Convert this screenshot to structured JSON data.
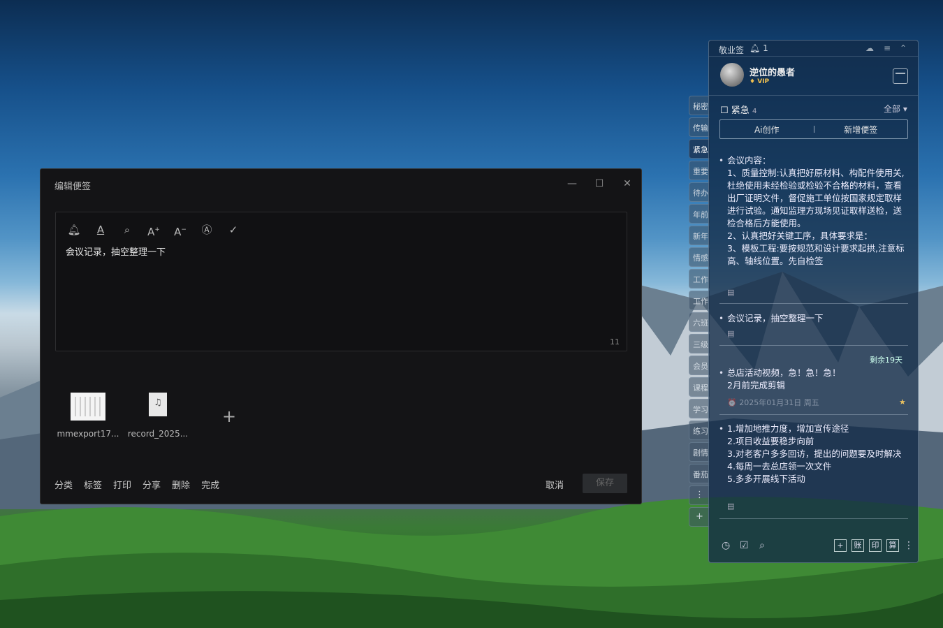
{
  "editor": {
    "title": "编辑便签",
    "window_controls": {
      "minimize": "—",
      "maximize": "☐",
      "close": "✕"
    },
    "toolbar": [
      "bell-icon",
      "text-underline-icon",
      "search-icon",
      "font-increase-icon",
      "font-decrease-icon",
      "auto-format-icon",
      "check-icon"
    ],
    "content": "会议记录，抽空整理一下",
    "char_count": "11",
    "attachments": [
      {
        "name": "mmexport17...",
        "type": "image"
      },
      {
        "name": "record_2025...",
        "type": "wav"
      }
    ],
    "add_attachment": "+",
    "actions": [
      "分类",
      "标签",
      "打印",
      "分享",
      "删除",
      "完成"
    ],
    "cancel": "取消",
    "save": "保存"
  },
  "side_tabs": [
    "秘密",
    "传输",
    "紧急",
    "重要",
    "待办",
    "年前",
    "新年",
    "情感",
    "工作",
    "工作",
    "六班",
    "三级",
    "会员",
    "课程",
    "学习",
    "练习",
    "剧情",
    "番茄"
  ],
  "side_tab_more": "⋮",
  "side_tab_add": "+",
  "panel": {
    "app_name": "敬业签",
    "reminder_count": "1",
    "user": {
      "name": "逆位的愚者",
      "badge": "VIP"
    },
    "category": {
      "name": "紧急",
      "count": "4",
      "filter": "全部"
    },
    "ai_button": "Ai创作",
    "new_button": "新增便签",
    "notes": [
      {
        "text": "会议内容：\n1、质量控制:认真把好原材料、构配件使用关,杜绝使用未经检验或检验不合格的材料，查看出厂证明文件，督促施工单位按国家规定取样进行试验。通知监理方现场见证取样送检，送检合格后方能使用。\n2、认真把好关键工序，具体要求是：\n3、模板工程:要按规范和设计要求起拱,注意标高、轴线位置。先自检签"
      },
      {
        "text": "会议记录，抽空整理一下"
      },
      {
        "text": "总店活动视频，急！急！急！\n2月前完成剪辑",
        "remaining": "剩余19天",
        "date": "2025年01月31日 周五"
      },
      {
        "text": "1.增加地推力度，增加宣传途径\n2.项目收益要稳步向前\n3.对老客户多多回访，提出的问题要及时解决\n4.每周一去总店领一次文件\n5.多多开展线下活动"
      }
    ],
    "bottom_icons": [
      "clock-icon",
      "calendar-check-icon",
      "search-icon"
    ],
    "bottom_boxes": [
      "+",
      "账",
      "印",
      "算"
    ],
    "more": "⋮"
  }
}
